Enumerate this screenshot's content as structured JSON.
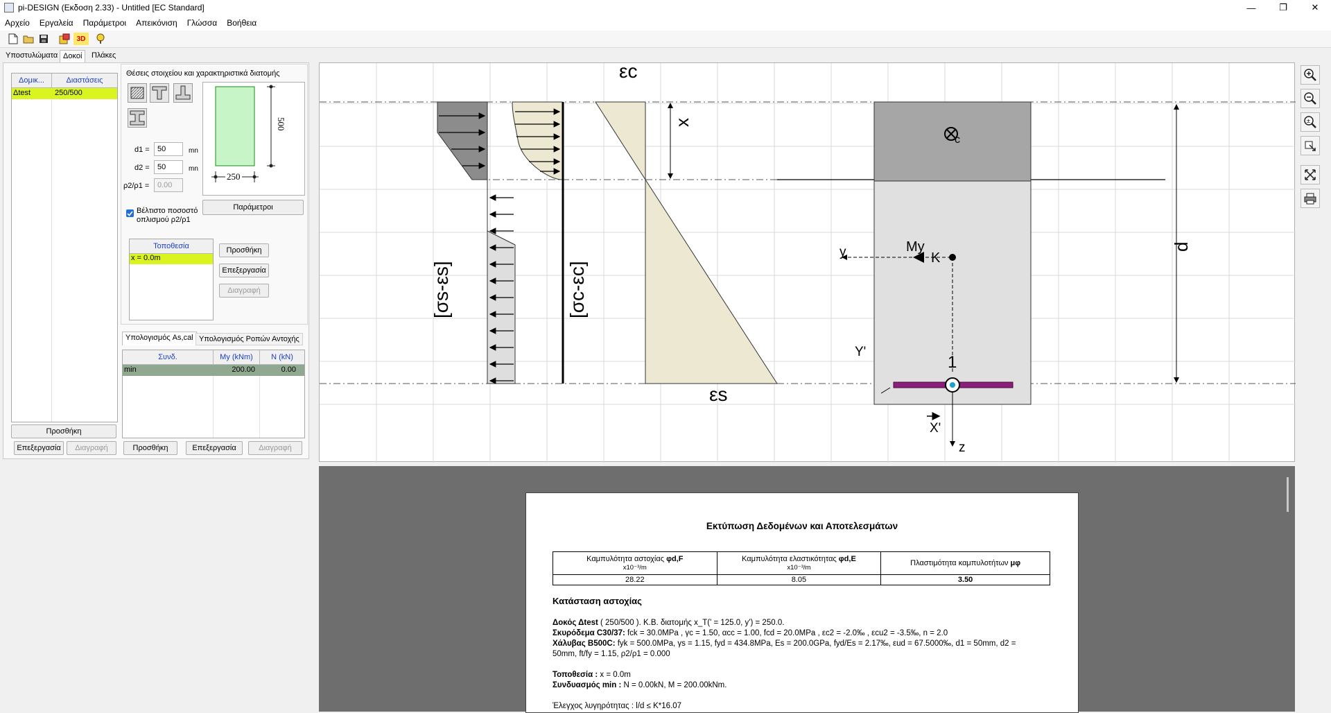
{
  "window": {
    "title": "pi-DESIGN (Εκδοση 2.33) - Untitled [EC Standard]",
    "minimize": "—",
    "maximize": "❐",
    "close": "✕"
  },
  "menu": [
    "Αρχείο",
    "Εργαλεία",
    "Παράμετροι",
    "Απεικόνιση",
    "Γλώσσα",
    "Βοήθεια"
  ],
  "toolbar": {
    "label_3d": "3D"
  },
  "tabs": [
    "Υποστυλώματα",
    "Δοκοί",
    "Πλάκες"
  ],
  "beams_grid": {
    "headers": [
      "Δομικ...",
      "Διαστάσεις"
    ],
    "rows": [
      {
        "name": "Δtest",
        "dims": "250/500"
      }
    ]
  },
  "left_buttons": {
    "add": "Προσθήκη",
    "edit": "Επεξεργασία",
    "delete": "Διαγραφή"
  },
  "section": {
    "heading": "Θέσεις στοιχείου και χαρακτηριστικά διατομής",
    "d1_label": "d1 =",
    "d1_value": "50",
    "d1_unit": "mn",
    "d2_label": "d2 =",
    "d2_value": "50",
    "d2_unit": "mn",
    "rho_label": "ρ2/ρ1 =",
    "rho_value": "0.00",
    "height_dim": "500",
    "width_dim": "250",
    "params_button": "Παράμετροι",
    "optimal_checkbox": "Βέλτιστο ποσοστό οπλισμού ρ2/ρ1",
    "optimal_checked": true
  },
  "locations": {
    "header": "Τοποθεσία",
    "rows": [
      "x = 0.0m"
    ],
    "add": "Προσθήκη",
    "edit": "Επεξεργασία",
    "delete": "Διαγραφή"
  },
  "calc_tabs": [
    "Υπολογισμός As,cal",
    "Υπολογισμός Ροπών Αντοχής"
  ],
  "combos": {
    "headers": [
      "Συνδ.",
      "My (kNm)",
      "N (kN)"
    ],
    "rows": [
      {
        "name": "min",
        "my": "200.00",
        "n": "0.00"
      }
    ],
    "add": "Προσθήκη",
    "edit": "Επεξεργασία",
    "delete": "Διαγραφή"
  },
  "diagram": {
    "eps_c": "εc",
    "eps_s": "εs",
    "x_label": "x",
    "d_label": "d",
    "stress_steel": "[σs-εs]",
    "stress_concrete": "[σc-εc]",
    "y": "y",
    "My": "My",
    "K": "K",
    "Yp": "Y'",
    "Xp": "X'",
    "z": "z",
    "c": "c",
    "bar_no": "1"
  },
  "report": {
    "title": "Εκτύπωση Δεδομένων και Αποτελεσμάτων",
    "table": {
      "h1": "Καμπυλότητα αστοχίας ",
      "h1_sym": "φd,F",
      "h1_unit": "x10⁻³/m",
      "h2": "Καμπυλότητα ελαστικότητας ",
      "h2_sym": "φd,E",
      "h2_unit": "x10⁻³/m",
      "h3": "Πλαστιμότητα καμπυλοτήτων ",
      "h3_sym": "μφ",
      "v1": "28.22",
      "v2": "8.05",
      "v3": "3.50"
    },
    "state_title": "Κατάσταση αστοχίας",
    "beam_bold": "Δοκός Δtest",
    "beam_rest": " (  250/500 ). Κ.Β. διατομής x_T(' = 125.0, y') = 250.0.",
    "concrete_bold": "Σκυρόδεμα C30/37:",
    "concrete_rest": " fck = 30.0MPa , γc = 1.50, αcc = 1.00, fcd = 20.0MPa , εc2 = -2.0‰ , εcu2 = -3.5‰, n = 2.0",
    "steel_bold": "Χάλυβας B500C:",
    "steel_rest1": " fyk = 500.0MPa, γs = 1.15, fyd = 434.8MPa, Es = 200.0GPa, fyd/Es = 2.17‰, εud = 67.5000‰, d1 = 50mm, d2 =",
    "steel_rest2": "50mm, ft/fy = 1.15, ρ2/ρ1 = 0.000",
    "loc_bold": "Τοποθεσία :",
    "loc_rest": " x = 0.0m",
    "combo_bold": "Συνδυασμός min :",
    "combo_rest": " N = 0.00kN, M = 200.00kNm.",
    "slender": "Έλεγχος λυγηρότητας : l/d ≤ K*16.07"
  }
}
